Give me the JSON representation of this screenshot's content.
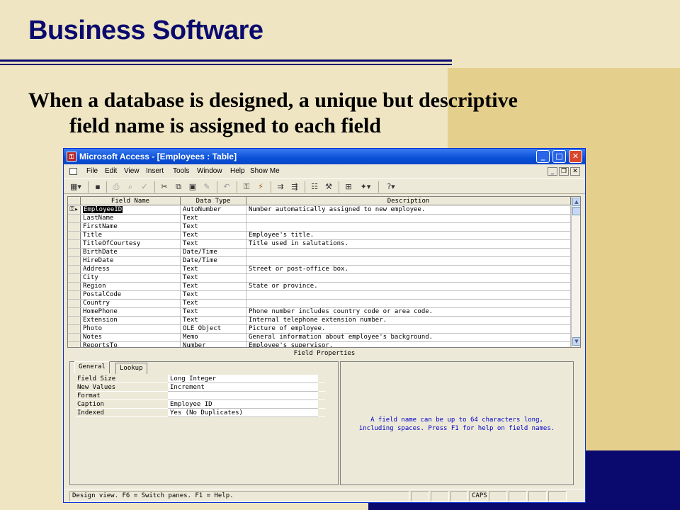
{
  "slide": {
    "title": "Business Software",
    "body_line1": "When a database is designed, a unique but descriptive",
    "body_line2": "field name is assigned to each field"
  },
  "window": {
    "title": "Microsoft Access - [Employees : Table]",
    "app_icon": "access-key-icon",
    "minimize": "_",
    "maximize": "□",
    "close": "✕"
  },
  "menu": {
    "items": [
      "File",
      "Edit",
      "View",
      "Insert",
      "Tools",
      "Window",
      "Help",
      "Show Me"
    ],
    "mdi_minimize": "_",
    "mdi_restore": "❐",
    "mdi_close": "✕"
  },
  "toolbar": {
    "icons": [
      "view-icon",
      "save-icon",
      "print-icon",
      "print-preview-icon",
      "spelling-icon",
      "cut-icon",
      "copy-icon",
      "paste-icon",
      "format-painter-icon",
      "undo-icon",
      "primary-key-icon",
      "indexes-icon",
      "insert-rows-icon",
      "delete-rows-icon",
      "properties-icon",
      "build-icon",
      "database-window-icon",
      "new-object-icon",
      "help-icon"
    ]
  },
  "table": {
    "headers": [
      "Field Name",
      "Data Type",
      "Description"
    ],
    "rows": [
      {
        "name": "EmployeeID",
        "type": "AutoNumber",
        "desc": "Number automatically assigned to new employee."
      },
      {
        "name": "LastName",
        "type": "Text",
        "desc": ""
      },
      {
        "name": "FirstName",
        "type": "Text",
        "desc": ""
      },
      {
        "name": "Title",
        "type": "Text",
        "desc": "Employee's title."
      },
      {
        "name": "TitleOfCourtesy",
        "type": "Text",
        "desc": "Title used in salutations."
      },
      {
        "name": "BirthDate",
        "type": "Date/Time",
        "desc": ""
      },
      {
        "name": "HireDate",
        "type": "Date/Time",
        "desc": ""
      },
      {
        "name": "Address",
        "type": "Text",
        "desc": "Street or post-office box."
      },
      {
        "name": "City",
        "type": "Text",
        "desc": ""
      },
      {
        "name": "Region",
        "type": "Text",
        "desc": "State or province."
      },
      {
        "name": "PostalCode",
        "type": "Text",
        "desc": ""
      },
      {
        "name": "Country",
        "type": "Text",
        "desc": ""
      },
      {
        "name": "HomePhone",
        "type": "Text",
        "desc": "Phone number includes country code or area code."
      },
      {
        "name": "Extension",
        "type": "Text",
        "desc": "Internal telephone extension number."
      },
      {
        "name": "Photo",
        "type": "OLE Object",
        "desc": "Picture of employee."
      },
      {
        "name": "Notes",
        "type": "Memo",
        "desc": "General information about employee's background."
      },
      {
        "name": "ReportsTo",
        "type": "Number",
        "desc": "Employee's supervisor."
      }
    ]
  },
  "field_properties": {
    "label": "Field Properties",
    "tabs": [
      "General",
      "Lookup"
    ],
    "props": [
      {
        "name": "Field Size",
        "value": "Long Integer"
      },
      {
        "name": "New Values",
        "value": "Increment"
      },
      {
        "name": "Format",
        "value": ""
      },
      {
        "name": "Caption",
        "value": "Employee ID"
      },
      {
        "name": "Indexed",
        "value": "Yes (No Duplicates)"
      }
    ],
    "help_line1": "A field name can be up to 64 characters long,",
    "help_line2": "including spaces.  Press F1 for help on field names."
  },
  "status": {
    "text": "Design view.  F6 = Switch panes.  F1 = Help.",
    "caps": "CAPS"
  },
  "colors": {
    "title_blue": "#0a0a6e",
    "slide_bg": "#efe5c2",
    "gold_panel": "#e5cf8c",
    "xp_title": "#0a4fd8"
  }
}
